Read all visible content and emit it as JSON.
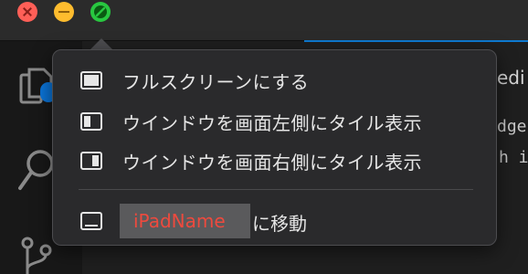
{
  "window_controls": {
    "close": "close-button",
    "minimize": "minimize-button",
    "zoom": "zoom-button"
  },
  "background_editor": {
    "line1_fragment": "edi",
    "line2_fragment": "dge",
    "line3_fragment": "h i"
  },
  "window_menu": {
    "items": [
      {
        "label": "フルスクリーンにする",
        "icon": "fullscreen-icon"
      },
      {
        "label": "ウインドウを画面左側にタイル表示",
        "icon": "tile-left-icon"
      },
      {
        "label": "ウインドウを画面右側にタイル表示",
        "icon": "tile-right-icon"
      }
    ],
    "move_to_device": {
      "device_name": "iPadName",
      "suffix": "に移動",
      "icon": "ipad-icon"
    }
  },
  "colors": {
    "close": "#ff5f57",
    "minimize": "#febc2e",
    "zoom": "#28c840",
    "accent": "#0e7ad1",
    "device_name": "#ee4a3e"
  }
}
